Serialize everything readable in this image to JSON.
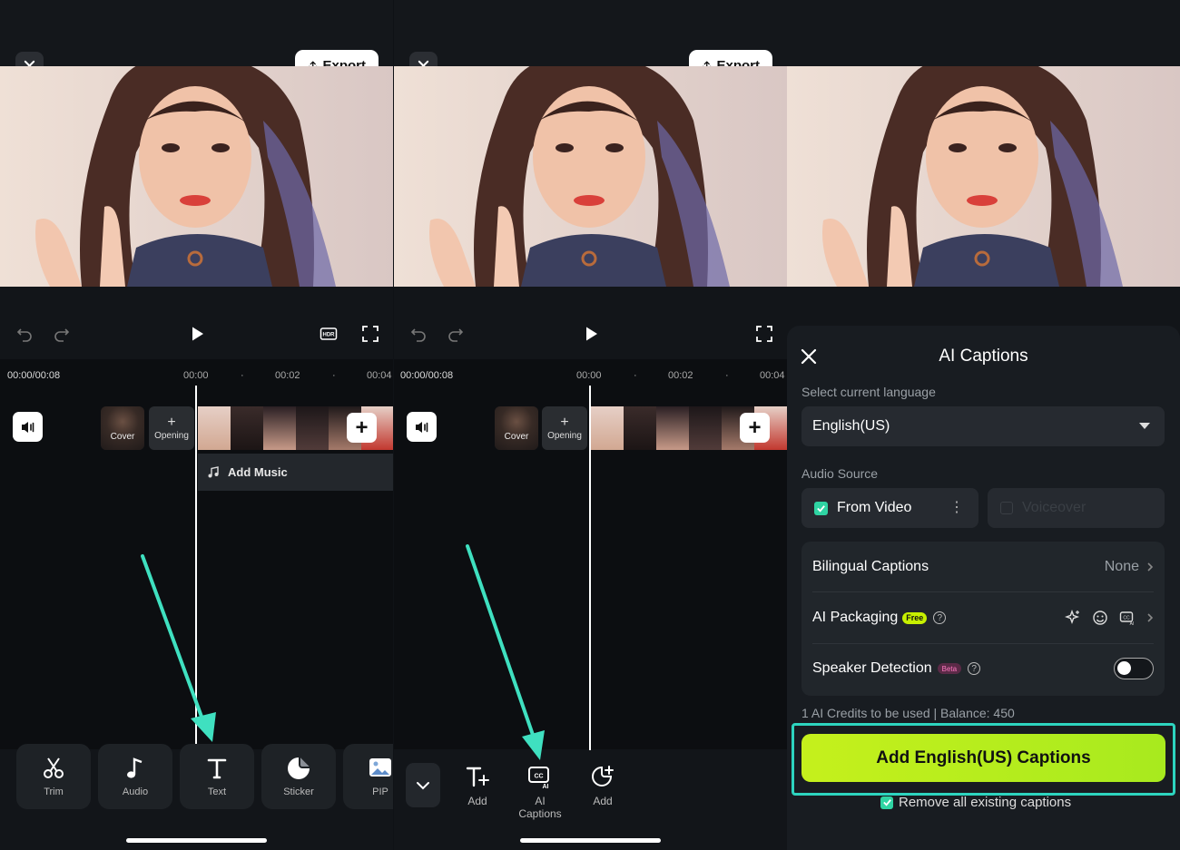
{
  "colors": {
    "accent_green": "#c5f01c",
    "teal_highlight": "#2dd4bf",
    "check_green": "#2fd4a3"
  },
  "panel1": {
    "export_label": "Export",
    "timecode": "00:00/00:08",
    "ticks": [
      "00:00",
      "00:02",
      "00:04"
    ],
    "cover_label": "Cover",
    "opening_label": "Opening",
    "add_music_label": "Add Music",
    "tools": [
      {
        "label": "Trim",
        "icon": "scissors-icon"
      },
      {
        "label": "Audio",
        "icon": "music-note-icon"
      },
      {
        "label": "Text",
        "icon": "text-icon"
      },
      {
        "label": "Sticker",
        "icon": "sticker-icon"
      },
      {
        "label": "PIP",
        "icon": "pip-icon"
      }
    ]
  },
  "panel2": {
    "export_label": "Export",
    "timecode": "00:00/00:08",
    "ticks": [
      "00:00",
      "00:02",
      "00:04"
    ],
    "cover_label": "Cover",
    "opening_label": "Opening",
    "tools": [
      {
        "label": "Add",
        "icon": "add-text-icon"
      },
      {
        "label": "AI\nCaptions",
        "icon": "ai-captions-icon"
      },
      {
        "label": "Add",
        "icon": "add-sticker-icon"
      }
    ]
  },
  "panel3": {
    "title": "AI Captions",
    "language_label": "Select current language",
    "language_value": "English(US)",
    "audio_source_label": "Audio Source",
    "audio_sources": [
      {
        "label": "From Video",
        "checked": true
      },
      {
        "label": "Voiceover",
        "checked": false
      }
    ],
    "bilingual_label": "Bilingual Captions",
    "bilingual_value": "None",
    "ai_packaging_label": "AI Packaging",
    "free_badge": "Free",
    "speaker_label": "Speaker Detection",
    "beta_badge": "Beta",
    "credits_text": "1 AI Credits to be used |  Balance: 450",
    "cta_label": "Add English(US) Captions",
    "remove_label": "Remove all existing captions"
  }
}
